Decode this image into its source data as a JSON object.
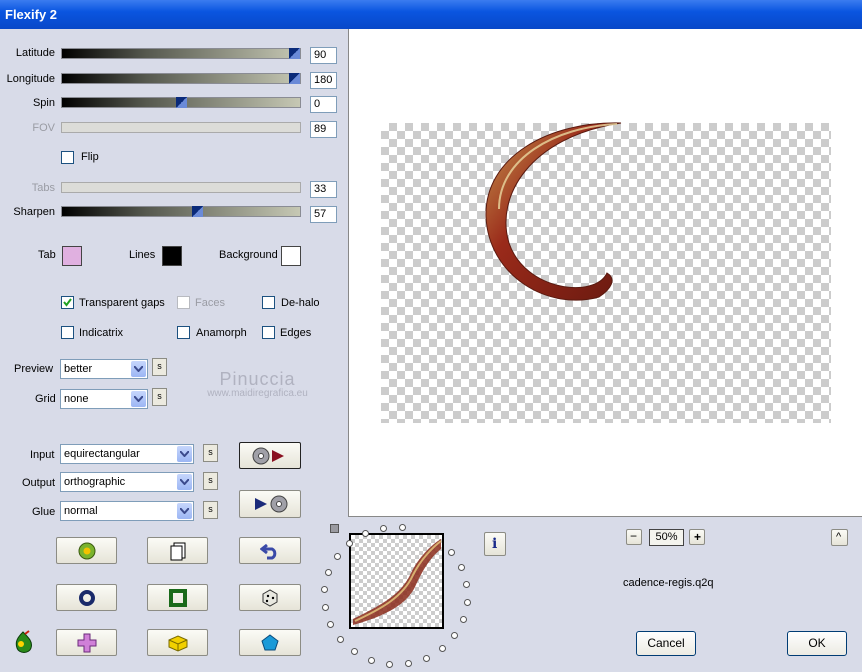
{
  "window": {
    "title": "Flexify 2"
  },
  "sliders": [
    {
      "label": "Latitude",
      "value": "90",
      "fraction": 1.0,
      "enabled": true
    },
    {
      "label": "Longitude",
      "value": "180",
      "fraction": 1.0,
      "enabled": true
    },
    {
      "label": "Spin",
      "value": "0",
      "fraction": 0.5,
      "enabled": true
    },
    {
      "label": "FOV",
      "value": "89",
      "enabled": false
    },
    {
      "label": "Tabs",
      "value": "33",
      "enabled": false
    },
    {
      "label": "Sharpen",
      "value": "57",
      "fraction": 0.57,
      "enabled": true
    }
  ],
  "flip": {
    "label": "Flip",
    "checked": false
  },
  "colors": {
    "tab": {
      "label": "Tab",
      "color": "#e0b0e0"
    },
    "lines": {
      "label": "Lines",
      "color": "#000000"
    },
    "background": {
      "label": "Background",
      "color": "#ffffff"
    }
  },
  "options": {
    "transparent_gaps": {
      "label": "Transparent gaps",
      "checked": true
    },
    "faces": {
      "label": "Faces",
      "checked": false,
      "enabled": false
    },
    "de_halo": {
      "label": "De-halo",
      "checked": false
    },
    "indicatrix": {
      "label": "Indicatrix",
      "checked": false
    },
    "anamorph": {
      "label": "Anamorph",
      "checked": false
    },
    "edges": {
      "label": "Edges",
      "checked": false
    }
  },
  "preview_select": {
    "label": "Preview",
    "value": "better"
  },
  "grid_select": {
    "label": "Grid",
    "value": "none"
  },
  "input_select": {
    "label": "Input",
    "value": "equirectangular"
  },
  "output_select": {
    "label": "Output",
    "value": "orthographic"
  },
  "glue_select": {
    "label": "Glue",
    "value": "normal"
  },
  "s_label": "s",
  "watermark": {
    "name": "Pinuccia",
    "url": "www.maidiregrafica.eu"
  },
  "zoom": {
    "minus": "−",
    "value": "50%",
    "plus": "+"
  },
  "scroll_up": "^",
  "filename": "cadence-regis.q2q",
  "info_label": "i",
  "buttons": {
    "cancel": "Cancel",
    "ok": "OK"
  },
  "accent": "#0a55e0"
}
